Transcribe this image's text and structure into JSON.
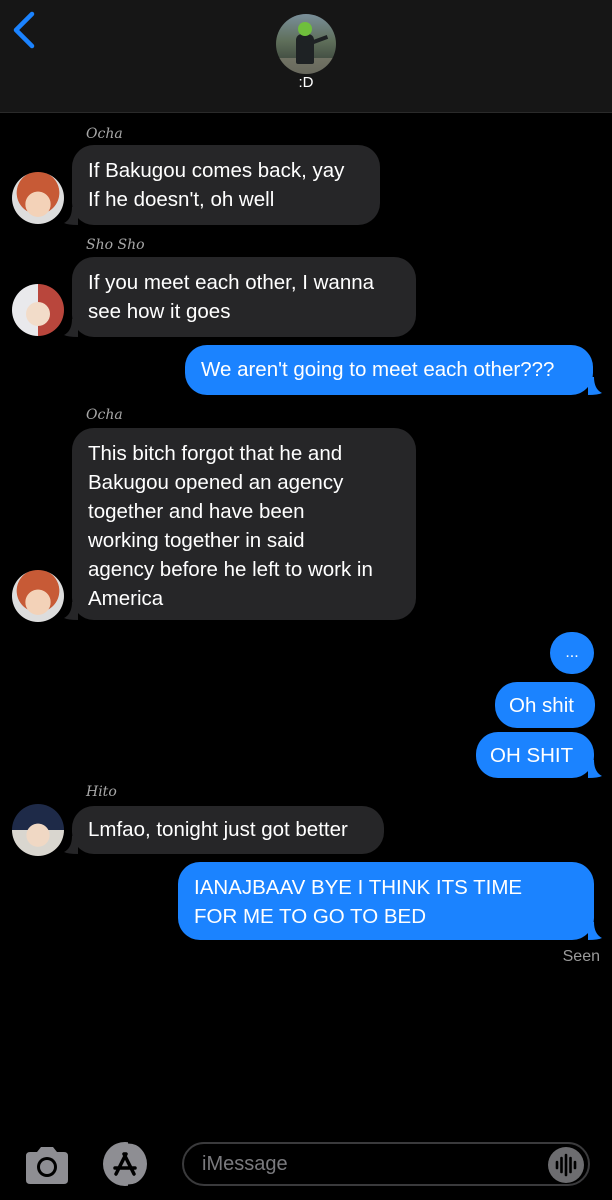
{
  "header": {
    "group_name": ":D"
  },
  "messages": [
    {
      "sender": "Ocha",
      "text": "If Bakugou comes back, yay\nIf he doesn't, oh well",
      "direction": "in"
    },
    {
      "sender": "Sho Sho",
      "text": "If you meet each other, I wanna\nsee how it goes",
      "direction": "in"
    },
    {
      "text": "We aren't going to meet each other???",
      "direction": "out"
    },
    {
      "sender": "Ocha",
      "text": "This bitch forgot that he and\nBakugou opened an agency\ntogether and have been\nworking  together  in said\nagency before he left to work in\nAmerica",
      "direction": "in"
    },
    {
      "text": "...",
      "direction": "out"
    },
    {
      "text": "Oh shit",
      "direction": "out"
    },
    {
      "text": "OH SHIT",
      "direction": "out"
    },
    {
      "sender": "Hito",
      "text": "Lmfao, tonight just got better",
      "direction": "in"
    },
    {
      "text": "IANAJBAAV BYE I THINK ITS TIME\nFOR ME TO GO TO BED",
      "direction": "out"
    }
  ],
  "status": {
    "seen": "Seen"
  },
  "compose": {
    "placeholder": "iMessage"
  },
  "colors": {
    "accent": "#1b83ff",
    "incoming_bubble": "#262628",
    "background": "#000000"
  },
  "icons": [
    "chevron-left-icon",
    "camera-icon",
    "app-store-icon",
    "audio-waveform-icon"
  ]
}
